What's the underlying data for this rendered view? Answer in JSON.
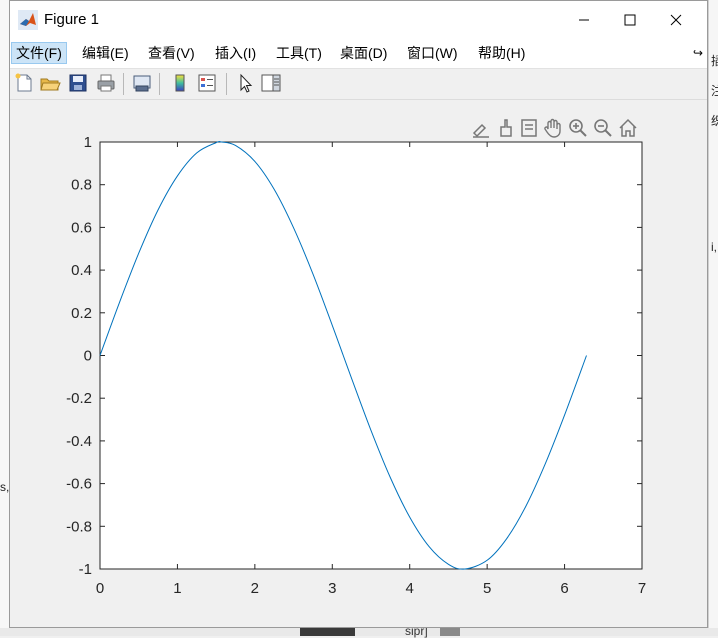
{
  "window": {
    "title": "Figure 1",
    "controls": {
      "minimize": "minimize",
      "maximize": "maximize",
      "close": "close"
    }
  },
  "menu": [
    {
      "label": "文件(F)",
      "active": true
    },
    {
      "label": "编辑(E)"
    },
    {
      "label": "查看(V)"
    },
    {
      "label": "插入(I)"
    },
    {
      "label": "工具(T)"
    },
    {
      "label": "桌面(D)"
    },
    {
      "label": "窗口(W)"
    },
    {
      "label": "帮助(H)"
    }
  ],
  "toolbar": [
    "new-figure-icon",
    "open-file-icon",
    "save-icon",
    "print-icon",
    "link-plot-icon",
    "insert-colorbar-icon",
    "insert-legend-icon",
    "edit-plot-arrow-icon",
    "property-inspector-icon"
  ],
  "axes_toolbar": [
    "brush-edit-icon",
    "data-cursor-icon",
    "export-icon",
    "pan-hand-icon",
    "zoom-in-icon",
    "zoom-out-icon",
    "restore-home-icon"
  ],
  "background": {
    "right_fragments": [
      "插",
      "注",
      "织",
      "i,"
    ],
    "left_fragments": [
      "s,"
    ],
    "bottom_fragment": "sipr]"
  },
  "chart_data": {
    "type": "line",
    "title": "",
    "xlabel": "",
    "ylabel": "",
    "xlim": [
      0,
      7
    ],
    "ylim": [
      -1,
      1
    ],
    "xticks": [
      "0",
      "1",
      "2",
      "3",
      "4",
      "5",
      "6",
      "7"
    ],
    "yticks": [
      "-1",
      "-0.8",
      "-0.6",
      "-0.4",
      "-0.2",
      "0",
      "0.2",
      "0.4",
      "0.6",
      "0.8",
      "1"
    ],
    "series": [
      {
        "color": "#0072bd",
        "x": [
          0,
          0.25,
          0.5,
          0.75,
          1.0,
          1.25,
          1.5,
          1.5708,
          1.75,
          2.0,
          2.25,
          2.5,
          2.75,
          3.0,
          3.1416,
          3.25,
          3.5,
          3.75,
          4.0,
          4.25,
          4.5,
          4.7124,
          5.0,
          5.25,
          5.5,
          5.75,
          6.0,
          6.2832
        ],
        "y": [
          0,
          0.247,
          0.479,
          0.682,
          0.841,
          0.949,
          0.997,
          1.0,
          0.984,
          0.909,
          0.778,
          0.598,
          0.382,
          0.141,
          0.0,
          -0.108,
          -0.351,
          -0.572,
          -0.757,
          -0.895,
          -0.978,
          -1.0,
          -0.959,
          -0.859,
          -0.706,
          -0.508,
          -0.279,
          0.0
        ]
      }
    ]
  }
}
